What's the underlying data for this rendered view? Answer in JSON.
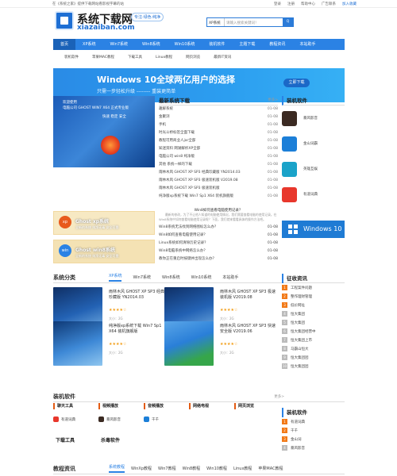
{
  "topbar": {
    "left": "在《系统之家》提供下载网站看影视字幕的站",
    "links": [
      "登录",
      "注册",
      "帮助中心",
      "广告联系"
    ],
    "favorite": "加入收藏"
  },
  "logo": {
    "title": "系统下载网",
    "url": "xiazaiban.com",
    "slogan": "专注·绿色·纯净"
  },
  "search": {
    "select": "XP系统",
    "placeholder": "请输入搜索关键词！",
    "button": "Q"
  },
  "nav": [
    "首页",
    "XP系统",
    "Win7系统",
    "Win8系统",
    "Win10系统",
    "装机软件",
    "主题下载",
    "教程资讯",
    "本站助手"
  ],
  "subnav": [
    "装机软件",
    "苹果MAC教程",
    "下载工具",
    "Linux教程",
    "网页浏览",
    "最新IT资讯"
  ],
  "banner": {
    "title": "Windows 10全球两亿用户的选择",
    "subtitle": "只需一步轻松升级 -------- 重装更简单",
    "button": "立即下载"
  },
  "feature": {
    "lines": [
      "欢迎使用",
      "电脑公司 GHOST WIN7 X64 正式专业版",
      "快速 稳定 安全"
    ]
  },
  "latest": {
    "title": "最新系统下载",
    "more": "更多>",
    "items": [
      {
        "t": "趣解系统",
        "d": "01-08"
      },
      {
        "t": "金聚浏",
        "d": "01-08"
      },
      {
        "t": "手机",
        "d": "01-08"
      },
      {
        "t": "时光斗桥标签全面下载",
        "d": "01-08"
      },
      {
        "t": "教程可用商业人jar全部",
        "d": "01-08"
      },
      {
        "t": "知迷资料 网湖解析XP全部",
        "d": "01-08"
      },
      {
        "t": "电脑公司 win8 纯净版",
        "d": "01-08"
      },
      {
        "t": "其他 系统一样的下载",
        "d": "01-08"
      },
      {
        "t": "雨林木风 GHOST XP SP3 经典珍藏版 YN2014.03",
        "d": "01-08"
      },
      {
        "t": "雨林木风 GHOST XP SP3 极速装机版 V2019.08",
        "d": "01-08"
      },
      {
        "t": "雨林木风 GHOST XP SP3 极速装机版",
        "d": "01-08"
      },
      {
        "t": "纯净版xp系统下载 Win7 Sp1 X64 装机旗舰版",
        "d": "01-08"
      }
    ]
  },
  "software": {
    "title": "装机软件",
    "items": [
      "暴风影音",
      "金山词霸",
      "英雄互娱",
      "万象游戏",
      "有道词典"
    ]
  },
  "ads": [
    {
      "t1": "Ghost xp系统",
      "t2": "全新的系统 纯净无毒 安全可靠",
      "c": "xp"
    },
    {
      "t1": "Ghost win8系统",
      "t2": "全新的系统 纯净无毒 安全可靠",
      "c": "win"
    }
  ],
  "qa": {
    "q": "Win8如何查看电脑使用记录？",
    "p": "最新的修改，为了不让他人知道的电脑使用情况，我们需要查看电脑的使用记录。在Win8系统中如何查看电脑使用记录呢？下面，我们就来看看具体的操作方法吧。",
    "items": [
      {
        "t": "Win8系统无法找到网络图标怎么办？",
        "d": "01-08"
      },
      {
        "t": "Win8如何查看电脑使用记录？",
        "d": "01-08"
      },
      {
        "t": "Linux系统如何清除历史记录？",
        "d": "01-08"
      },
      {
        "t": "Win8电脑系统中网络怎么办？",
        "d": "01-08"
      },
      {
        "t": "教你正在重启时按键并出现怎么办？",
        "d": "01-08"
      }
    ]
  },
  "win10": "Windows 10",
  "sys": {
    "title": "系统分类",
    "tabs": [
      "XP系统",
      "Win7系统",
      "Win8系统",
      "Win10系统",
      "本站助手"
    ],
    "more": "更多>",
    "cards": [
      {
        "n": "雨林木风 GHOST XP SP3 经典珍藏版 YN2014.03",
        "z": "大小：2G"
      },
      {
        "n": "雨林木风 GHOST XP SP3 极速装机版 V2019.08",
        "z": "大小：2G"
      },
      {
        "n": "纯净版xp系统下载 Win7 Sp1 X64 装机旗舰版",
        "z": "大小：2G"
      },
      {
        "n": "雨林木风 GHOST XP SP3 快速安全版 V2019.06",
        "z": "大小：2G"
      }
    ],
    "stars": "★★★★☆"
  },
  "rank": {
    "title": "征收资讯",
    "items": [
      "工程案件问题",
      "整作理财管理",
      "低价网址",
      "恒大集团",
      "恒大集团",
      "恒大集团经营中",
      "恒大集团上市",
      "马霸山恒大",
      "恒大集团团",
      "恒大集团团"
    ]
  },
  "install": {
    "title": "装机软件",
    "more": "更多>",
    "cols": [
      {
        "h": "聊天工具",
        "i": "有道词典"
      },
      {
        "h": "视频播放",
        "i": "暴风影音"
      },
      {
        "h": "音频播放",
        "i": "千千"
      },
      {
        "h": "网络电视",
        "i": ""
      },
      {
        "h": "网页浏览",
        "i": ""
      }
    ],
    "bottom": [
      "下载工具",
      "杀毒软件"
    ],
    "right": {
      "title": "装机软件",
      "items": [
        "有道词典",
        "千千",
        "金山词",
        "暴风影音"
      ]
    }
  },
  "tutorials": {
    "title": "教程资讯",
    "tabs": [
      "系统教程",
      "WinXp教程",
      "Win7教程",
      "Win8教程",
      "Win10教程",
      "Linux教程",
      "苹果MAC教程"
    ]
  }
}
